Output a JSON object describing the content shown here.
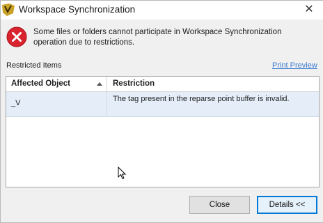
{
  "window": {
    "title": "Workspace Synchronization",
    "close_glyph": "✕"
  },
  "message": {
    "icon": "error-icon",
    "text": "Some files or folders cannot participate in Workspace Synchronization operation due to restrictions."
  },
  "restricted": {
    "label": "Restricted Items",
    "print_preview": "Print Preview"
  },
  "grid": {
    "columns": [
      {
        "label": "Affected Object",
        "sort": "ascending"
      },
      {
        "label": "Restriction"
      }
    ],
    "rows": [
      {
        "object": "_V",
        "restriction": "The tag present in the reparse point buffer is invalid."
      }
    ]
  },
  "buttons": {
    "close": "Close",
    "details": "Details <<"
  },
  "colors": {
    "accent": "#0078d7",
    "error_red": "#d9232e",
    "link": "#3b7bd0",
    "selected_row": "#e4edf8"
  }
}
